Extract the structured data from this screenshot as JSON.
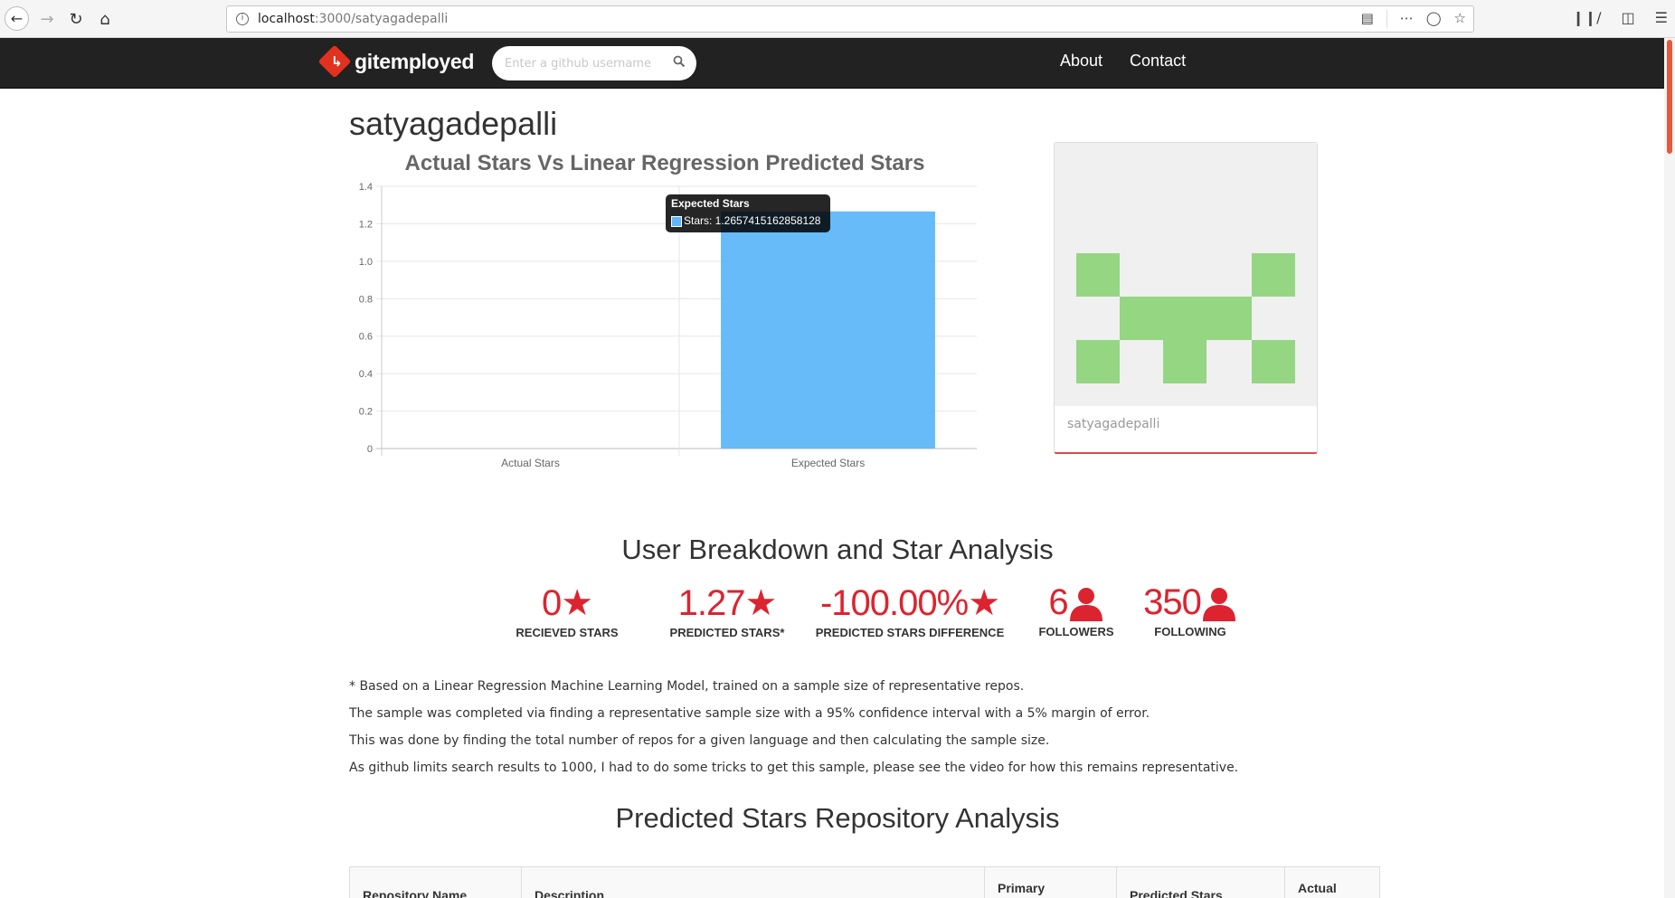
{
  "browser": {
    "url_host": "localhost",
    "url_path": ":3000/satyagadepalli"
  },
  "navbar": {
    "brand": "gitemployed",
    "search_placeholder": "Enter a github username",
    "links": [
      "About",
      "Contact"
    ]
  },
  "profile": {
    "username": "satyagadepalli",
    "card_name": "satyagadepalli"
  },
  "chart_data": {
    "type": "bar",
    "title": "Actual Stars Vs Linear Regression Predicted Stars",
    "categories": [
      "Actual Stars",
      "Expected Stars"
    ],
    "series": [
      {
        "name": "Stars",
        "values": [
          0,
          1.2657415162858128
        ]
      }
    ],
    "ylim": [
      0,
      1.4
    ],
    "yticks": [
      "0",
      "0.2",
      "0.4",
      "0.6",
      "0.8",
      "1.0",
      "1.2",
      "1.4"
    ],
    "grid": true,
    "bar_color": "#5eb7f8",
    "tooltip": {
      "title": "Expected Stars",
      "body": "Stars: 1.2657415162858128"
    }
  },
  "breakdown": {
    "title": "User Breakdown and Star Analysis",
    "stats": [
      {
        "value": "0",
        "icon": "star-icon",
        "label": "RECIEVED STARS"
      },
      {
        "value": "1.27",
        "icon": "star-icon",
        "label": "PREDICTED STARS*"
      },
      {
        "value": "-100.00%",
        "icon": "star-icon",
        "label": "PREDICTED STARS DIFFERENCE"
      },
      {
        "value": "6",
        "icon": "user-icon",
        "label": "FOLLOWERS"
      },
      {
        "value": "350",
        "icon": "user-icon",
        "label": "FOLLOWING"
      }
    ],
    "accent_color": "#dc2430"
  },
  "notes": [
    "* Based on a Linear Regression Machine Learning Model, trained on a sample size of representative repos.",
    "The sample was completed via finding a representative sample size with a 95% confidence interval with a 5% margin of error.",
    "This was done by finding the total number of repos for a given language and then calculating the sample size.",
    "As github limits search results to 1000, I had to do some tricks to get this sample, please see the video for how this remains representative."
  ],
  "repo_analysis": {
    "title": "Predicted Stars Repository Analysis",
    "columns": [
      "Repository Name",
      "Description",
      "Primary",
      "Predicted Stars",
      "Actual"
    ]
  }
}
